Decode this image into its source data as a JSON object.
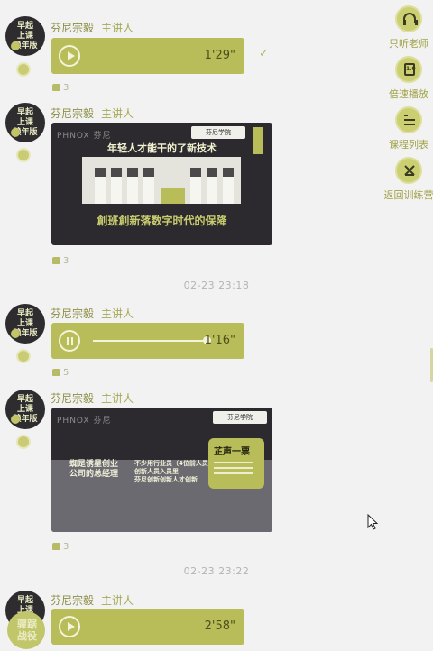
{
  "speaker": {
    "name": "芬尼宗毅",
    "role": "主讲人",
    "avatar_text": "早起\n上课\n赖年版",
    "avatar_text_last": "骤踞\n战役"
  },
  "timestamps": [
    "02-23 23:18",
    "02-23 23:22"
  ],
  "messages": [
    {
      "type": "audio",
      "duration": "1'29\"",
      "likes": "3"
    },
    {
      "type": "image",
      "likes": "3",
      "brand": "PHNOX 芬尼",
      "logo": "芬尼学院",
      "headline": "年轻人才能干的了新技术",
      "banner": "創班創新落数字时代的保降"
    },
    {
      "type": "audio",
      "state": "playing",
      "duration": "1'16\"",
      "likes": "5",
      "progress": 0.95
    },
    {
      "type": "image",
      "likes": "3",
      "brand": "PHNOX 芬尼",
      "logo": "芬尼学院",
      "tag_title": "芷声一票",
      "left_text": "蜘是诱星创业\n公司的总经理",
      "mid_text": "不少用行业员（4位前人员）\n创新人员入员里\n芬尼创新创新人才创新"
    },
    {
      "type": "audio",
      "duration": "2'58\"",
      "likes": ""
    }
  ],
  "side_menu": [
    {
      "label": "只听老师",
      "icon": "headphones-icon"
    },
    {
      "label": "倍速播放",
      "icon": "speed-icon",
      "icon_text": "1.0"
    },
    {
      "label": "课程列表",
      "icon": "list-icon"
    },
    {
      "label": "返回训练营",
      "icon": "tent-icon"
    }
  ],
  "colors": {
    "accent": "#b9bd59",
    "dark": "#2c2a2e",
    "bg": "#f2f2f2"
  }
}
